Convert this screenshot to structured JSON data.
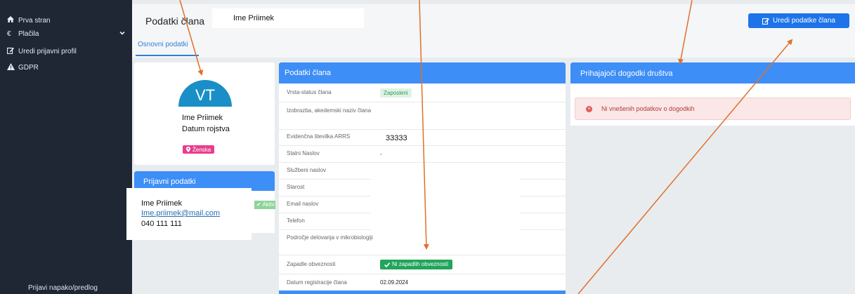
{
  "sidebar": {
    "items": [
      {
        "icon": "home-icon",
        "glyph": "🏠",
        "label": "Prva stran"
      },
      {
        "icon": "euro-icon",
        "glyph": "€",
        "label": "Plačila"
      },
      {
        "icon": "edit-icon",
        "glyph": "✎",
        "label": "Uredi prijavni profil"
      },
      {
        "icon": "warning-icon",
        "glyph": "▲",
        "label": "GDPR"
      }
    ],
    "footer": "Prijavi napako/predlog"
  },
  "header": {
    "title": "Podatki člana",
    "name": "Ime Priimek",
    "edit_button": "Uredi podatke člana",
    "tab": "Osnovni podatki"
  },
  "profile": {
    "initials": "VT",
    "name": "Ime Priimek",
    "dob": "Datum rojstva",
    "gender": "Ženska"
  },
  "login": {
    "title": "Prijavni podatki",
    "status": "Aktiv",
    "name": "Ime Priimek",
    "email": "Ime.priimek@mail.com",
    "phone": "040 111 111"
  },
  "member": {
    "title": "Podatki člana",
    "rows": {
      "status": "Vrsta-status člana",
      "education": "Izobrazba, akedemski naziv člana",
      "arrs": "Evidenčna številka ARRS",
      "address": "Stalni Naslov",
      "work_address": "Službeni naslov",
      "age": "Starost",
      "email": "Email naslov",
      "phone": "Telefon",
      "field": "Področje delovanja v mikrobiologiji",
      "obligations": "Zapadle obveznosti",
      "registered": "Datum registracije člana"
    },
    "values": {
      "status": "Zaposleni",
      "arrs": "33333",
      "address": ",",
      "obligations": "Ni zapadlih obveznosti",
      "registered": "02.09.2024"
    }
  },
  "events": {
    "title": "Prihajajoči dogodki društva",
    "alert": "Ni vnešenih podatkov o dogodkih"
  },
  "colors": {
    "sidebar": "#1f2735",
    "primary": "#3e8ef7",
    "button": "#1e73e8",
    "success": "#21a55a",
    "danger": "#e05a5a",
    "gender": "#e83e8c",
    "arrow": "#e0702a"
  }
}
